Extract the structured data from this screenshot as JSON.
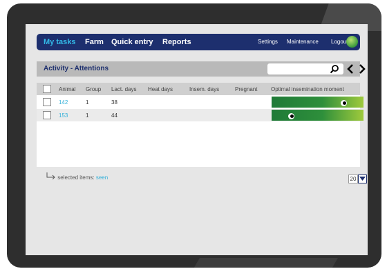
{
  "nav": {
    "items": [
      {
        "label": "My tasks",
        "active": true
      },
      {
        "label": "Farm"
      },
      {
        "label": "Quick entry"
      },
      {
        "label": "Reports"
      }
    ],
    "settings": "Settings",
    "maintenance": "Maintenance",
    "logout": "Logout"
  },
  "page": {
    "title": "Activity - Attentions"
  },
  "search": {
    "placeholder": ""
  },
  "table": {
    "columns": [
      "Animal",
      "Group",
      "Lact. days",
      "Heat days",
      "Insem. days",
      "Pregnant",
      "Optimal insemination moment"
    ],
    "rows": [
      {
        "animal": "142",
        "group": "1",
        "lact_days": "38",
        "heat_days": "",
        "insem_days": "",
        "pregnant": ""
      },
      {
        "animal": "153",
        "group": "1",
        "lact_days": "44",
        "heat_days": "",
        "insem_days": "",
        "pregnant": ""
      }
    ]
  },
  "footer": {
    "selected_label": "selected items:",
    "selected_action": "seen"
  },
  "pager": {
    "page_size": "20"
  },
  "colors": {
    "nav_bg": "#1d2f6e",
    "accent": "#33b8e6",
    "bar_start": "#1f7a38",
    "bar_end": "#9fca3c"
  }
}
